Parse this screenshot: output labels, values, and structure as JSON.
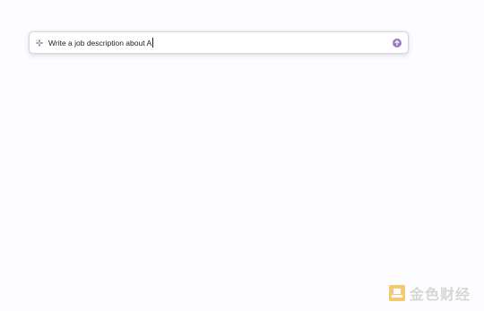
{
  "prompt": {
    "value": "Write a job description about A",
    "icon": "sparkle-icon",
    "send_icon": "arrow-up-icon",
    "send_color": "#9b7cc1"
  },
  "watermark": {
    "text": "金色财经",
    "logo_color": "#f2b338"
  }
}
